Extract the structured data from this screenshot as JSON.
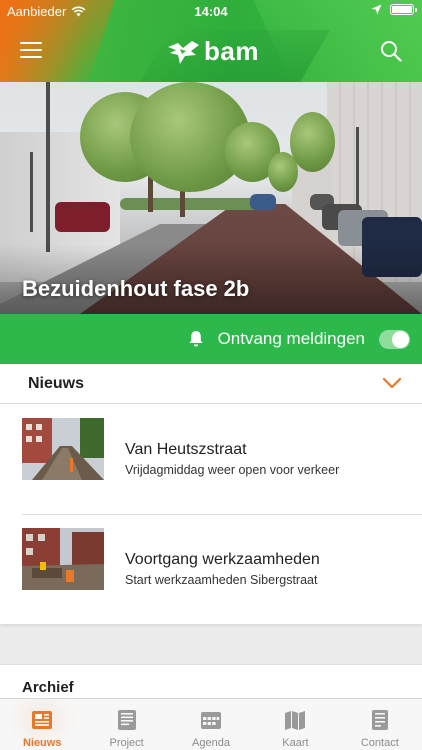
{
  "status_bar": {
    "carrier": "Aanbieder",
    "time": "14:04"
  },
  "header": {
    "logo_text": "bam",
    "menu_icon": "hamburger-icon",
    "search_icon": "search-icon",
    "colors": {
      "green": "#2fae3c",
      "orange": "#f07a1a"
    }
  },
  "project": {
    "title": "Bezuidenhout fase 2b"
  },
  "notifications": {
    "label": "Ontvang meldingen",
    "enabled": true,
    "bar_color": "#2db84b"
  },
  "news": {
    "heading": "Nieuws",
    "items": [
      {
        "title": "Van Heutszstraat",
        "subtitle": "Vrijdagmiddag weer open voor verkeer"
      },
      {
        "title": "Voortgang werkzaamheden",
        "subtitle": "Start werkzaamheden Sibergstraat"
      }
    ]
  },
  "archive": {
    "heading": "Archief"
  },
  "tabs": [
    {
      "label": "Nieuws",
      "icon": "newspaper-icon",
      "active": true
    },
    {
      "label": "Project",
      "icon": "document-icon",
      "active": false
    },
    {
      "label": "Agenda",
      "icon": "calendar-icon",
      "active": false
    },
    {
      "label": "Kaart",
      "icon": "map-icon",
      "active": false
    },
    {
      "label": "Contact",
      "icon": "contact-card-icon",
      "active": false
    }
  ],
  "accent_color": "#e8782a"
}
